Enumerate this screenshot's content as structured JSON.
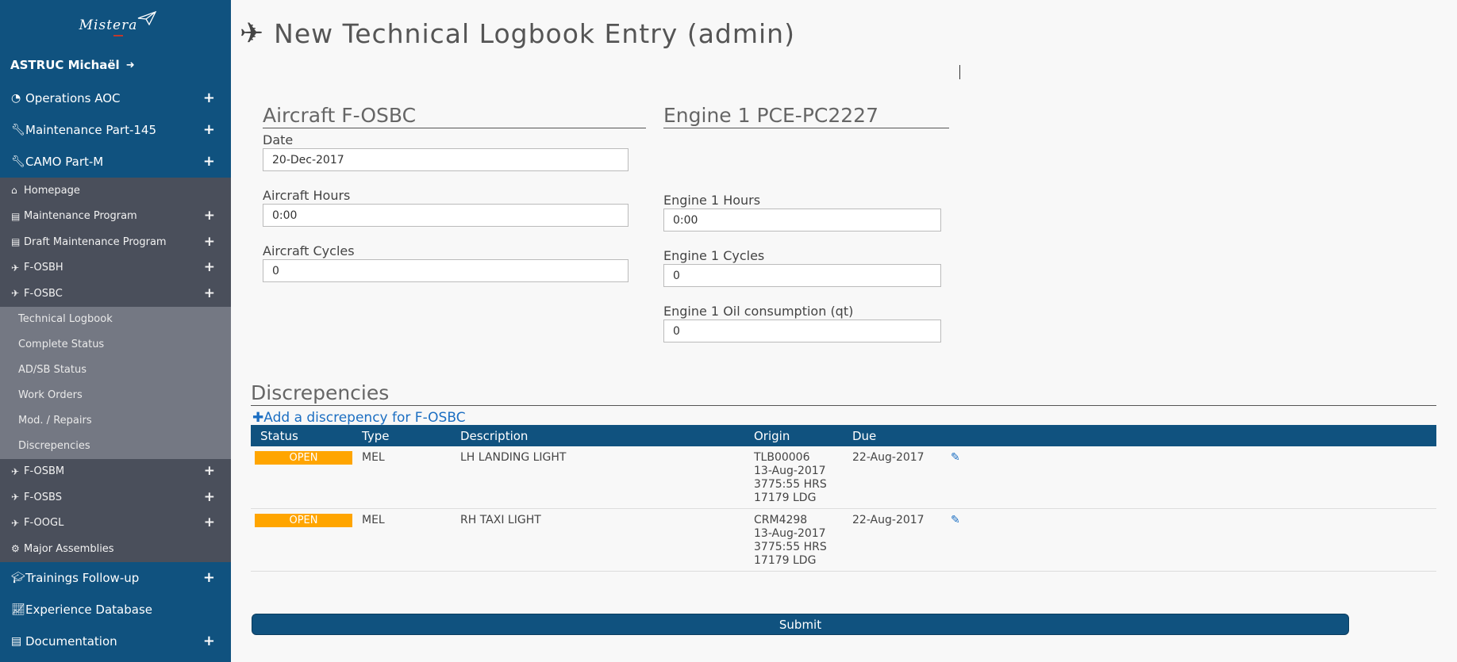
{
  "brand": {
    "logo_text": "Mistera"
  },
  "user": {
    "name": "ASTRUC Michaël"
  },
  "sidebar": {
    "top_items": [
      {
        "label": "Operations AOC",
        "icon": "dashboard-icon"
      },
      {
        "label": "Maintenance Part-145",
        "icon": "wrench-icon"
      },
      {
        "label": "CAMO Part-M",
        "icon": "wrench-icon"
      }
    ],
    "camo_items": [
      {
        "label": "Homepage",
        "icon": "home-icon"
      },
      {
        "label": "Maintenance Program",
        "icon": "book-icon"
      },
      {
        "label": "Draft Maintenance Program",
        "icon": "book-icon"
      },
      {
        "label": "F-OSBH",
        "icon": "plane-icon"
      },
      {
        "label": "F-OSBC",
        "icon": "plane-icon"
      }
    ],
    "fosbc_items": [
      {
        "label": "Technical Logbook"
      },
      {
        "label": "Complete Status"
      },
      {
        "label": "AD/SB Status"
      },
      {
        "label": "Work Orders"
      },
      {
        "label": "Mod. / Repairs"
      },
      {
        "label": "Discrepencies"
      }
    ],
    "more_items": [
      {
        "label": "F-OSBM",
        "icon": "plane-icon"
      },
      {
        "label": "F-OSBS",
        "icon": "plane-icon"
      },
      {
        "label": "F-OOGL",
        "icon": "plane-icon"
      },
      {
        "label": "Major Assemblies",
        "icon": "cogs-icon"
      }
    ],
    "bottom_items": [
      {
        "label": "Trainings Follow-up",
        "icon": "graduation-cap-icon"
      },
      {
        "label": "Experience Database",
        "icon": "area-chart-icon"
      },
      {
        "label": "Documentation",
        "icon": "book-icon"
      }
    ]
  },
  "page": {
    "title": "New Technical Logbook Entry (admin)"
  },
  "aircraft": {
    "heading": "Aircraft F-OSBC",
    "date_label": "Date",
    "date_value": "20-Dec-2017",
    "hours_label": "Aircraft Hours",
    "hours_value": "0:00",
    "cycles_label": "Aircraft Cycles",
    "cycles_value": "0"
  },
  "engine": {
    "heading": "Engine 1 PCE-PC2227",
    "hours_label": "Engine 1 Hours",
    "hours_value": "0:00",
    "cycles_label": "Engine 1 Cycles",
    "cycles_value": "0",
    "oil_label": "Engine 1 Oil consumption (qt)",
    "oil_value": "0"
  },
  "discrepencies": {
    "heading": "Discrepencies",
    "add_link": "Add a discrepency for F-OSBC",
    "columns": [
      "Status",
      "Type",
      "Description",
      "Origin",
      "Due"
    ],
    "rows": [
      {
        "status": "OPEN",
        "type": "MEL",
        "description": "LH LANDING LIGHT",
        "origin": [
          "TLB00006",
          "13-Aug-2017",
          "3775:55 HRS",
          "17179 LDG"
        ],
        "due": "22-Aug-2017"
      },
      {
        "status": "OPEN",
        "type": "MEL",
        "description": "RH TAXI LIGHT",
        "origin": [
          "CRM4298",
          "13-Aug-2017",
          "3775:55 HRS",
          "17179 LDG"
        ],
        "due": "22-Aug-2017"
      }
    ]
  },
  "submit_label": "Submit",
  "colors": {
    "primary": "#10527f",
    "status_open": "#ffa500",
    "due": "#e00000",
    "link": "#1b6ec2"
  }
}
